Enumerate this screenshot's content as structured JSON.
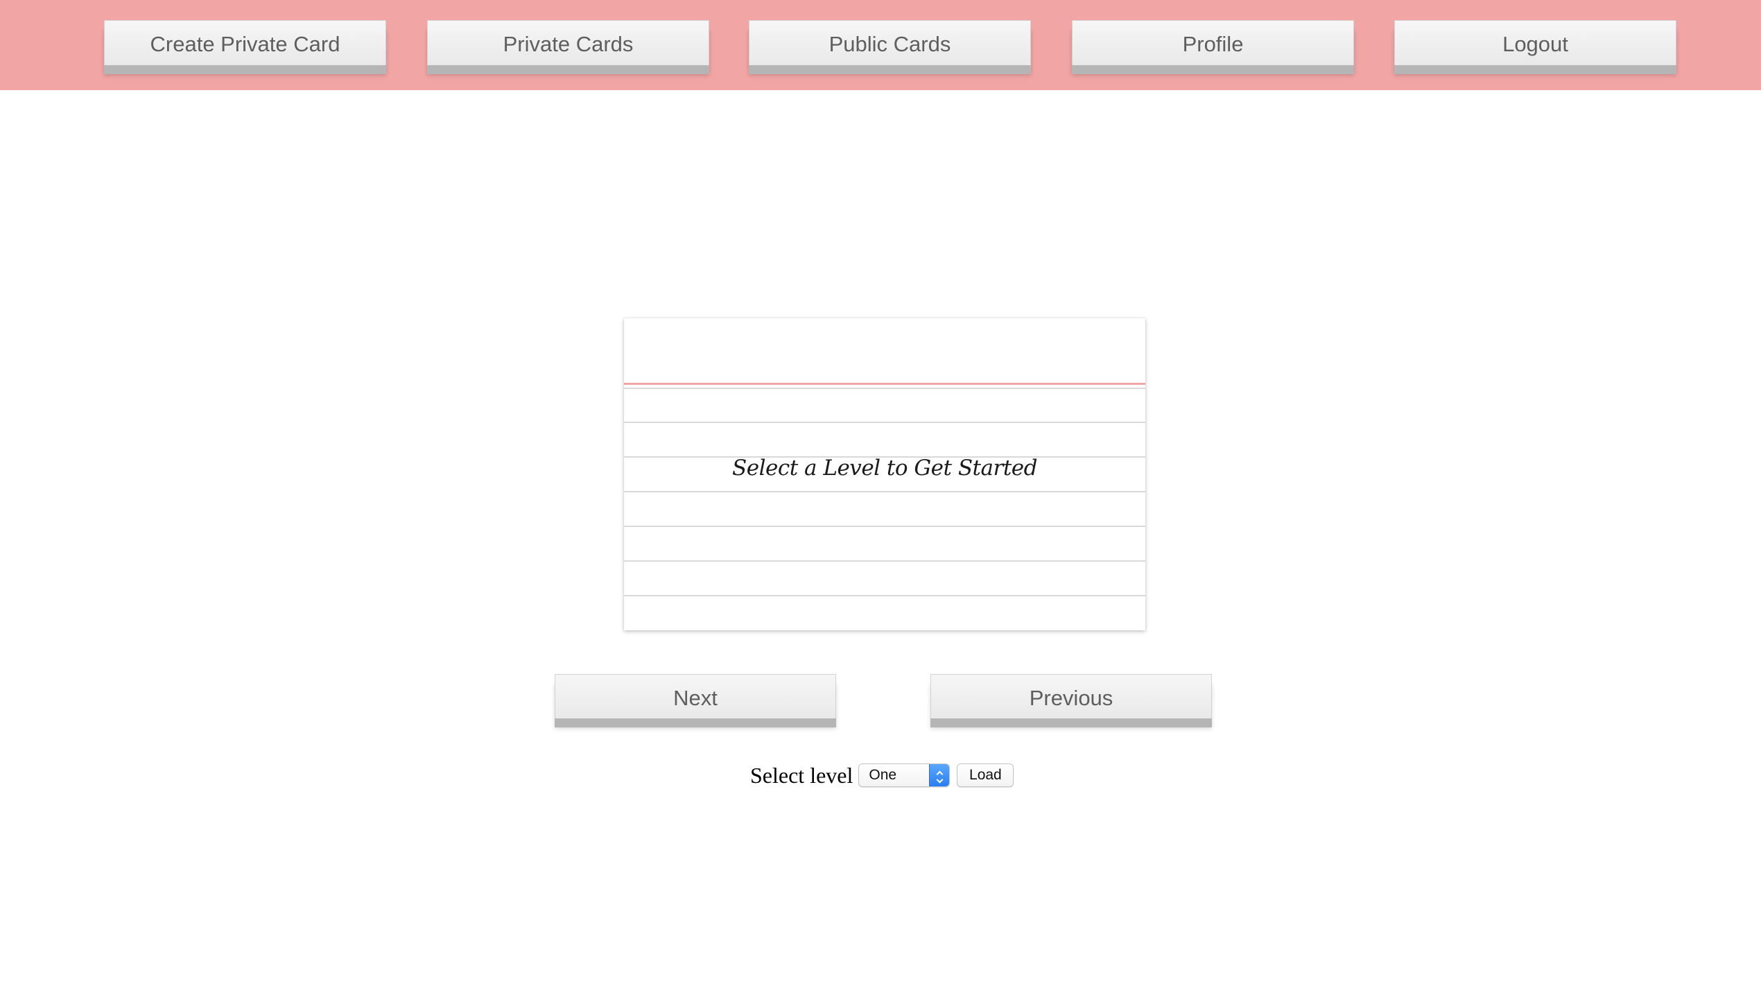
{
  "nav": {
    "items": [
      {
        "label": "Create Private Card"
      },
      {
        "label": "Private Cards"
      },
      {
        "label": "Public Cards"
      },
      {
        "label": "Profile"
      },
      {
        "label": "Logout"
      }
    ]
  },
  "card": {
    "message": "Select a Level to Get Started"
  },
  "pager": {
    "next_label": "Next",
    "previous_label": "Previous"
  },
  "level": {
    "label": "Select level",
    "selected": "One",
    "load_label": "Load"
  },
  "colors": {
    "topbar": "#f2a5a5",
    "card_header_rule": "#f2a5a5",
    "select_accent": "#2a7ef3"
  },
  "icons": {
    "select_arrows": "chevron-up-down-icon"
  }
}
